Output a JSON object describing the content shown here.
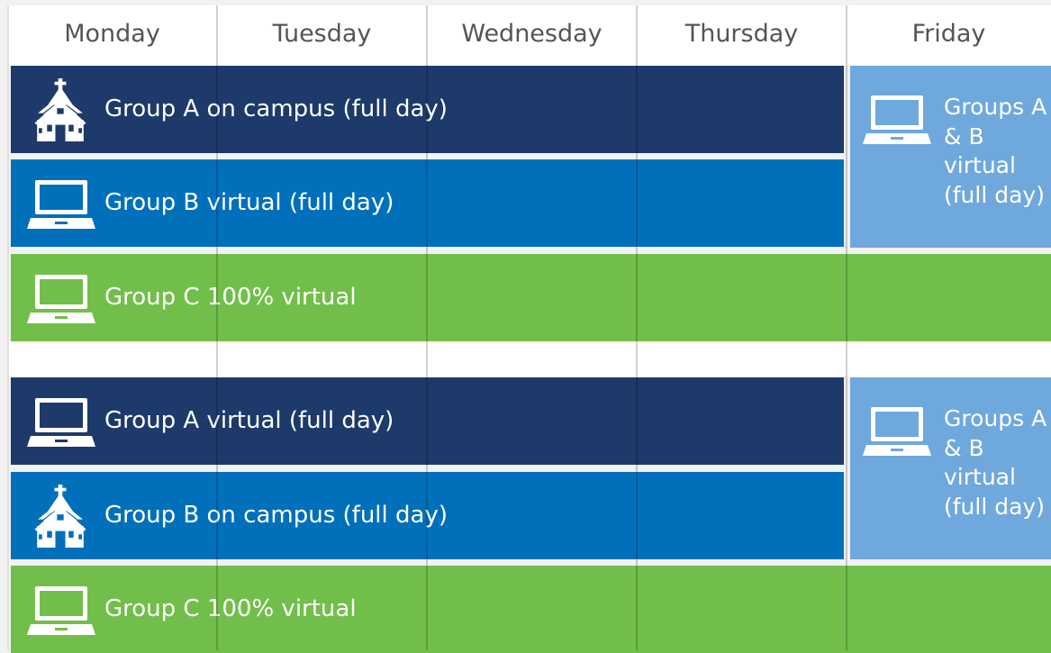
{
  "days": [
    "Monday",
    "Tuesday",
    "Wednesday",
    "Thursday",
    "Friday"
  ],
  "schedule_1": {
    "row_a": {
      "label": "Group A on campus (full day)",
      "icon": "school-icon",
      "color": "#1d3a6b"
    },
    "row_b": {
      "label": "Group B virtual (full day)",
      "icon": "laptop-icon",
      "color": "#0070bb"
    },
    "row_c": {
      "label": "Group C 100% virtual",
      "icon": "laptop-icon",
      "color": "#71bf4a"
    },
    "friday": {
      "label": "Groups A & B virtual (full day)",
      "icon": "laptop-icon",
      "color": "#6fa8dc"
    }
  },
  "schedule_2": {
    "row_a": {
      "label": "Group A virtual (full day)",
      "icon": "laptop-icon",
      "color": "#1d3a6b"
    },
    "row_b": {
      "label": "Group B on campus (full day)",
      "icon": "school-icon",
      "color": "#0070bb"
    },
    "row_c": {
      "label": "Group C 100% virtual",
      "icon": "laptop-icon",
      "color": "#71bf4a"
    },
    "friday": {
      "label": "Groups A & B virtual (full day)",
      "icon": "laptop-icon",
      "color": "#6fa8dc"
    }
  }
}
